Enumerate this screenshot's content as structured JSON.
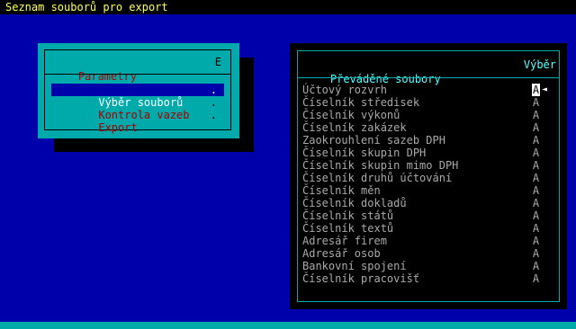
{
  "title": "Seznam souborů pro export",
  "menu": {
    "header": "Parametry",
    "header_key": "E",
    "items": [
      {
        "label": "Výběr souborů",
        "key": ".",
        "selected": true
      },
      {
        "label": "Kontrola vazeb",
        "key": ".",
        "selected": false
      },
      {
        "label": "Export",
        "key": ".",
        "selected": false
      }
    ]
  },
  "files": {
    "header_left": "Převáděné soubory",
    "header_right": "Výběr",
    "cursor_icon": "◄",
    "rows": [
      {
        "name": "Účtový rozvrh",
        "sel": "A"
      },
      {
        "name": "Číselník středisek",
        "sel": "A"
      },
      {
        "name": "Číselník výkonů",
        "sel": "A"
      },
      {
        "name": "Číselník zakázek",
        "sel": "A"
      },
      {
        "name": "Zaokrouhlení sazeb DPH",
        "sel": "A"
      },
      {
        "name": "Číselník skupin DPH",
        "sel": "A"
      },
      {
        "name": "Číselník skupin mimo DPH",
        "sel": "A"
      },
      {
        "name": "Číselník druhů účtování",
        "sel": "A"
      },
      {
        "name": "Číselník měn",
        "sel": "A"
      },
      {
        "name": "Číselník dokladů",
        "sel": "A"
      },
      {
        "name": "Číselník států",
        "sel": "A"
      },
      {
        "name": "Číselník textů",
        "sel": "A"
      },
      {
        "name": "Adresář firem",
        "sel": "A"
      },
      {
        "name": "Adresář osob",
        "sel": "A"
      },
      {
        "name": "Bankovní spojení",
        "sel": "A"
      },
      {
        "name": "Číselník pracovišť",
        "sel": "A"
      }
    ]
  },
  "colors": {
    "background": "#0000aa",
    "panel": "#00aaaa",
    "title_text": "#ffff55",
    "header_text": "#55ffff",
    "menu_text": "#aa0000"
  }
}
